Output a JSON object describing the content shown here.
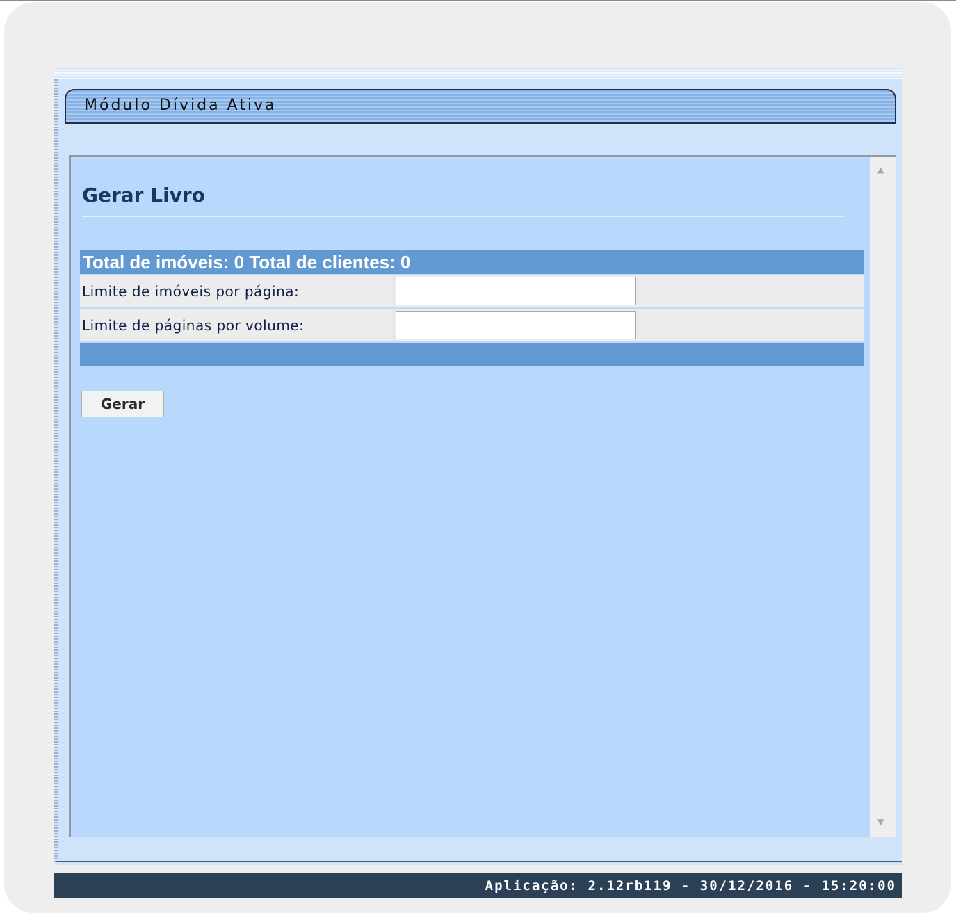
{
  "module": {
    "title": "Módulo Dívida Ativa"
  },
  "page": {
    "title": "Gerar Livro"
  },
  "totals": {
    "text": "Total de imóveis: 0 Total de clientes: 0"
  },
  "form": {
    "fields": [
      {
        "label": "Limite de imóveis por página:",
        "value": "",
        "placeholder": ""
      },
      {
        "label": "Limite de páginas por volume:",
        "value": "",
        "placeholder": ""
      }
    ],
    "submit_label": "Gerar"
  },
  "status_bar": {
    "text": "Aplicação: 2.12rb119 - 30/12/2016 - 15:20:00"
  },
  "icons": {
    "scroll_up": "scroll-up-arrow-icon",
    "scroll_down": "scroll-down-arrow-icon"
  },
  "colors": {
    "content_background": "#b8d9fc",
    "bar_blue": "#6299d0",
    "status_bar": "#2d4156",
    "title_text": "#163a5c"
  }
}
